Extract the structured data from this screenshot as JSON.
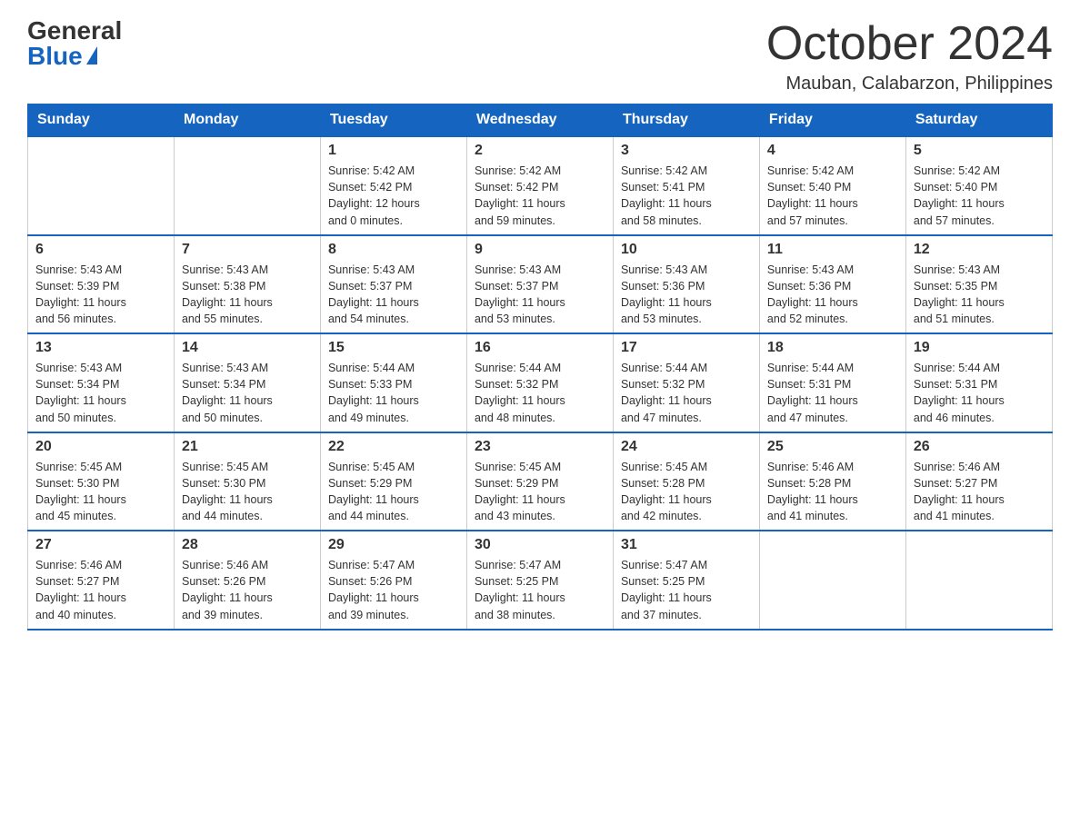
{
  "logo": {
    "general": "General",
    "blue": "Blue"
  },
  "title": "October 2024",
  "location": "Mauban, Calabarzon, Philippines",
  "days_header": [
    "Sunday",
    "Monday",
    "Tuesday",
    "Wednesday",
    "Thursday",
    "Friday",
    "Saturday"
  ],
  "weeks": [
    [
      {
        "day": "",
        "info": ""
      },
      {
        "day": "",
        "info": ""
      },
      {
        "day": "1",
        "info": "Sunrise: 5:42 AM\nSunset: 5:42 PM\nDaylight: 12 hours\nand 0 minutes."
      },
      {
        "day": "2",
        "info": "Sunrise: 5:42 AM\nSunset: 5:42 PM\nDaylight: 11 hours\nand 59 minutes."
      },
      {
        "day": "3",
        "info": "Sunrise: 5:42 AM\nSunset: 5:41 PM\nDaylight: 11 hours\nand 58 minutes."
      },
      {
        "day": "4",
        "info": "Sunrise: 5:42 AM\nSunset: 5:40 PM\nDaylight: 11 hours\nand 57 minutes."
      },
      {
        "day": "5",
        "info": "Sunrise: 5:42 AM\nSunset: 5:40 PM\nDaylight: 11 hours\nand 57 minutes."
      }
    ],
    [
      {
        "day": "6",
        "info": "Sunrise: 5:43 AM\nSunset: 5:39 PM\nDaylight: 11 hours\nand 56 minutes."
      },
      {
        "day": "7",
        "info": "Sunrise: 5:43 AM\nSunset: 5:38 PM\nDaylight: 11 hours\nand 55 minutes."
      },
      {
        "day": "8",
        "info": "Sunrise: 5:43 AM\nSunset: 5:37 PM\nDaylight: 11 hours\nand 54 minutes."
      },
      {
        "day": "9",
        "info": "Sunrise: 5:43 AM\nSunset: 5:37 PM\nDaylight: 11 hours\nand 53 minutes."
      },
      {
        "day": "10",
        "info": "Sunrise: 5:43 AM\nSunset: 5:36 PM\nDaylight: 11 hours\nand 53 minutes."
      },
      {
        "day": "11",
        "info": "Sunrise: 5:43 AM\nSunset: 5:36 PM\nDaylight: 11 hours\nand 52 minutes."
      },
      {
        "day": "12",
        "info": "Sunrise: 5:43 AM\nSunset: 5:35 PM\nDaylight: 11 hours\nand 51 minutes."
      }
    ],
    [
      {
        "day": "13",
        "info": "Sunrise: 5:43 AM\nSunset: 5:34 PM\nDaylight: 11 hours\nand 50 minutes."
      },
      {
        "day": "14",
        "info": "Sunrise: 5:43 AM\nSunset: 5:34 PM\nDaylight: 11 hours\nand 50 minutes."
      },
      {
        "day": "15",
        "info": "Sunrise: 5:44 AM\nSunset: 5:33 PM\nDaylight: 11 hours\nand 49 minutes."
      },
      {
        "day": "16",
        "info": "Sunrise: 5:44 AM\nSunset: 5:32 PM\nDaylight: 11 hours\nand 48 minutes."
      },
      {
        "day": "17",
        "info": "Sunrise: 5:44 AM\nSunset: 5:32 PM\nDaylight: 11 hours\nand 47 minutes."
      },
      {
        "day": "18",
        "info": "Sunrise: 5:44 AM\nSunset: 5:31 PM\nDaylight: 11 hours\nand 47 minutes."
      },
      {
        "day": "19",
        "info": "Sunrise: 5:44 AM\nSunset: 5:31 PM\nDaylight: 11 hours\nand 46 minutes."
      }
    ],
    [
      {
        "day": "20",
        "info": "Sunrise: 5:45 AM\nSunset: 5:30 PM\nDaylight: 11 hours\nand 45 minutes."
      },
      {
        "day": "21",
        "info": "Sunrise: 5:45 AM\nSunset: 5:30 PM\nDaylight: 11 hours\nand 44 minutes."
      },
      {
        "day": "22",
        "info": "Sunrise: 5:45 AM\nSunset: 5:29 PM\nDaylight: 11 hours\nand 44 minutes."
      },
      {
        "day": "23",
        "info": "Sunrise: 5:45 AM\nSunset: 5:29 PM\nDaylight: 11 hours\nand 43 minutes."
      },
      {
        "day": "24",
        "info": "Sunrise: 5:45 AM\nSunset: 5:28 PM\nDaylight: 11 hours\nand 42 minutes."
      },
      {
        "day": "25",
        "info": "Sunrise: 5:46 AM\nSunset: 5:28 PM\nDaylight: 11 hours\nand 41 minutes."
      },
      {
        "day": "26",
        "info": "Sunrise: 5:46 AM\nSunset: 5:27 PM\nDaylight: 11 hours\nand 41 minutes."
      }
    ],
    [
      {
        "day": "27",
        "info": "Sunrise: 5:46 AM\nSunset: 5:27 PM\nDaylight: 11 hours\nand 40 minutes."
      },
      {
        "day": "28",
        "info": "Sunrise: 5:46 AM\nSunset: 5:26 PM\nDaylight: 11 hours\nand 39 minutes."
      },
      {
        "day": "29",
        "info": "Sunrise: 5:47 AM\nSunset: 5:26 PM\nDaylight: 11 hours\nand 39 minutes."
      },
      {
        "day": "30",
        "info": "Sunrise: 5:47 AM\nSunset: 5:25 PM\nDaylight: 11 hours\nand 38 minutes."
      },
      {
        "day": "31",
        "info": "Sunrise: 5:47 AM\nSunset: 5:25 PM\nDaylight: 11 hours\nand 37 minutes."
      },
      {
        "day": "",
        "info": ""
      },
      {
        "day": "",
        "info": ""
      }
    ]
  ]
}
